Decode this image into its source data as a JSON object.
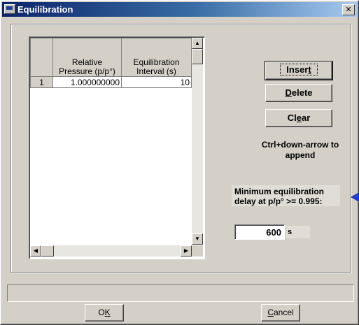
{
  "window": {
    "title": "Equilibration",
    "close_glyph": "✕"
  },
  "grid": {
    "columns": [
      {
        "label": "",
        "key": "row"
      },
      {
        "label": "Relative Pressure (p/p°)",
        "key": "pressure"
      },
      {
        "label": "Equilibration Interval (s)",
        "key": "interval"
      }
    ],
    "rows": [
      {
        "index": "1",
        "pressure": "1.000000000",
        "interval": "10"
      }
    ],
    "scroll_arrows": {
      "up": "▲",
      "down": "▼",
      "left": "◀",
      "right": "▶"
    }
  },
  "buttons": {
    "insert": {
      "text": "Insert",
      "mnemonic": "t"
    },
    "delete": {
      "text": "Delete",
      "mnemonic": "D"
    },
    "clear": {
      "text": "Clear",
      "mnemonic": "e"
    },
    "ok": {
      "text": "OK",
      "mnemonic": "K"
    },
    "cancel": {
      "text": "Cancel",
      "mnemonic": "C"
    }
  },
  "hint": "Ctrl+down-arrow to append",
  "min_delay": {
    "label": "Minimum equilibration delay at p/p° >= 0.995:",
    "value": "600",
    "unit": "s"
  },
  "status_text": "",
  "colors": {
    "arrow": "#1f3cd8",
    "title_start": "#0a246a"
  }
}
